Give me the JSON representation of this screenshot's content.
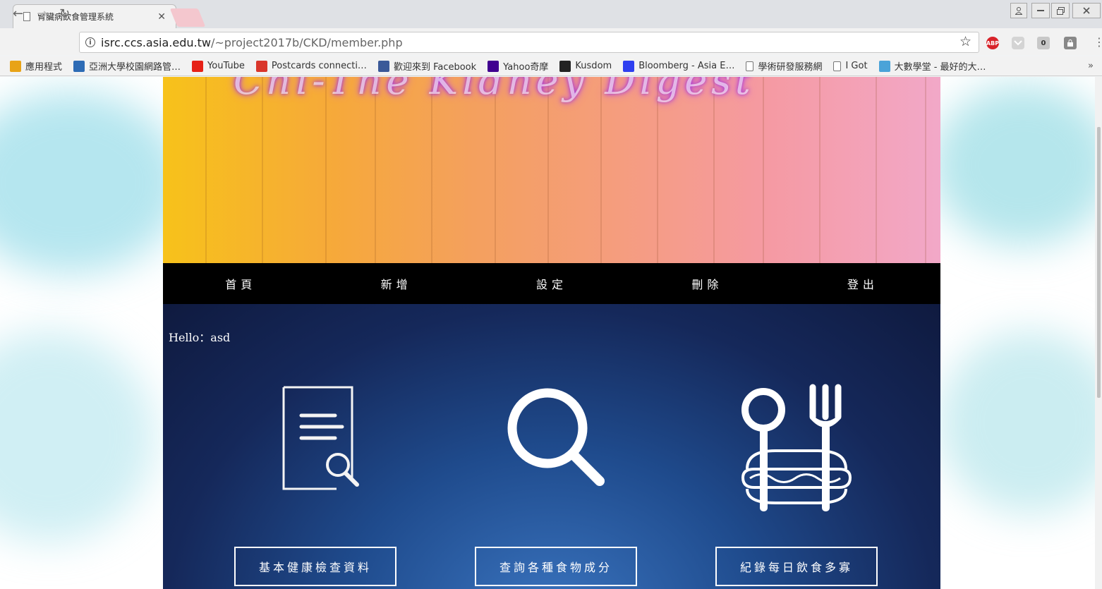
{
  "browser": {
    "tab_title": "腎臟病飲食管理系統",
    "tab_close": "✕",
    "url_host": "isrc.ccs.asia.edu.tw",
    "url_path": "/~project2017b/CKD/member.php",
    "ext_abp": "ABP",
    "ext_count": "0",
    "bookmarks": [
      {
        "label": "應用程式",
        "icon": "apps-grid-icon",
        "color": "#e8a317"
      },
      {
        "label": "亞洲大學校園網路管…",
        "icon": "asia-univ-icon",
        "color": "#2d6bb5"
      },
      {
        "label": "YouTube",
        "icon": "youtube-icon",
        "color": "#e62117"
      },
      {
        "label": "Postcards connecti…",
        "icon": "postcrossing-icon",
        "color": "#d9362b"
      },
      {
        "label": "歡迎來到 Facebook",
        "icon": "facebook-icon",
        "color": "#3b5998"
      },
      {
        "label": "Yahoo奇摩",
        "icon": "yahoo-icon",
        "color": "#400090"
      },
      {
        "label": "Kusdom",
        "icon": "kusdom-icon",
        "color": "#222222"
      },
      {
        "label": "Bloomberg - Asia E…",
        "icon": "bloomberg-icon",
        "color": "#2e3ff0"
      },
      {
        "label": "學術研發服務網",
        "icon": "page-icon",
        "color": "#ffffff"
      },
      {
        "label": "I Got",
        "icon": "page-icon",
        "color": "#ffffff"
      },
      {
        "label": "大數學堂 - 最好的大…",
        "icon": "bookmark-icon",
        "color": "#4aa3d8"
      }
    ],
    "bookmarks_more": "»"
  },
  "site": {
    "banner_title": "Chi-The Kidney Digest",
    "nav": [
      "首頁",
      "新增",
      "設定",
      "刪除",
      "登出"
    ],
    "greeting": "Hello：asd",
    "features": [
      {
        "icon": "health-report-icon",
        "button": "基本健康檢查資料"
      },
      {
        "icon": "search-icon",
        "button": "查詢各種食物成分"
      },
      {
        "icon": "meal-utensils-icon",
        "button": "紀錄每日飲食多寡"
      }
    ]
  },
  "colors": {
    "navbar_bg": "#000000",
    "content_bg": "#1a3a75",
    "banner_start": "#f7c21a",
    "banner_end": "#f2a8c8"
  }
}
